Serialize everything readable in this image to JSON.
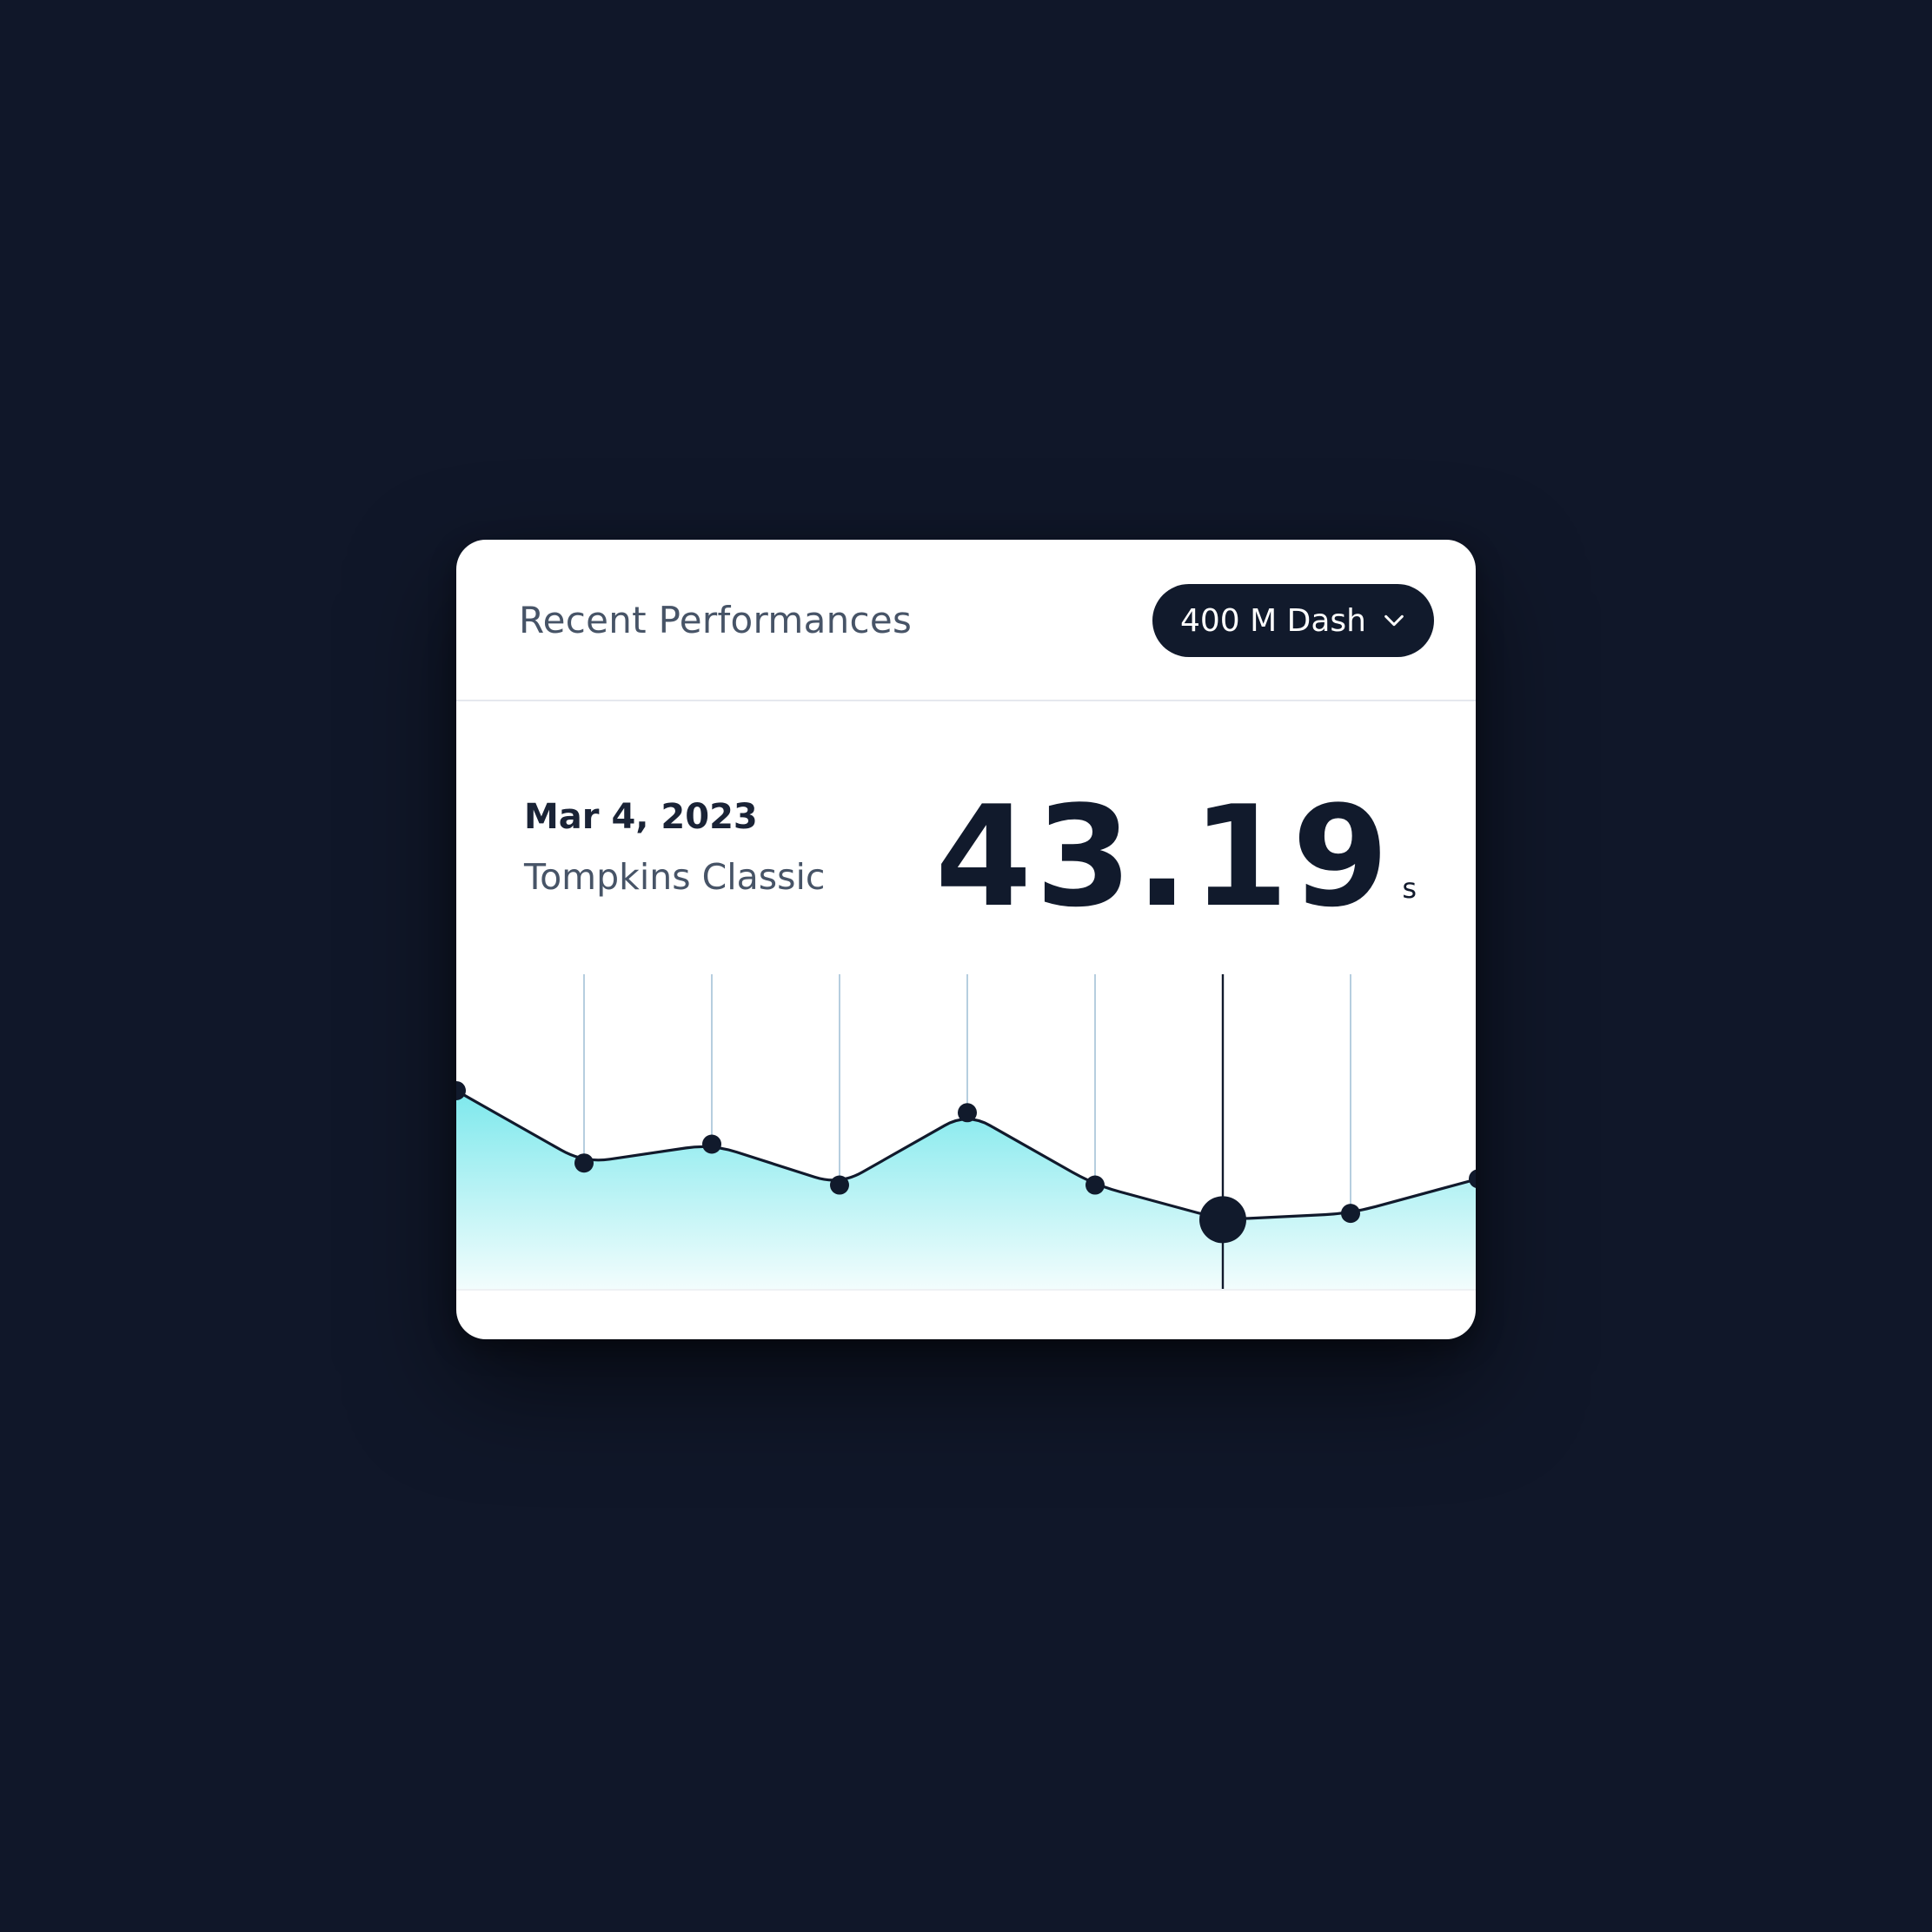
{
  "header": {
    "title": "Recent Performances",
    "event_selector": {
      "value": "400 M Dash",
      "icon": "chevron-down-icon"
    }
  },
  "selected_performance": {
    "date": "Mar 4, 2023",
    "meet": "Tompkins Classic",
    "time": "43.19",
    "unit": "s"
  },
  "colors": {
    "background": "#101729",
    "card": "#ffffff",
    "ink": "#111a2c",
    "area_top": "#7de8ec",
    "area_bottom": "#f2fdfd",
    "gridline": "#b6cedf"
  },
  "chart_data": {
    "type": "area",
    "points": [
      0.63,
      0.4,
      0.46,
      0.33,
      0.56,
      0.33,
      0.22,
      0.24,
      0.35
    ],
    "selected_index": 6,
    "ylim": [
      0,
      1
    ],
    "grid": true
  }
}
